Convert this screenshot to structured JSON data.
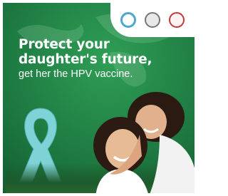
{
  "headline": {
    "line1": "Protect your",
    "line2": "daughter's future,"
  },
  "subhead": "get her the HPV vaccine.",
  "logos": [
    "circular-emblem-logo",
    "government-seal-logo",
    "medical-association-logo"
  ],
  "colors": {
    "background_green": "#1f7d43",
    "ribbon_teal": "#7fd3d6",
    "text": "#ffffff"
  }
}
